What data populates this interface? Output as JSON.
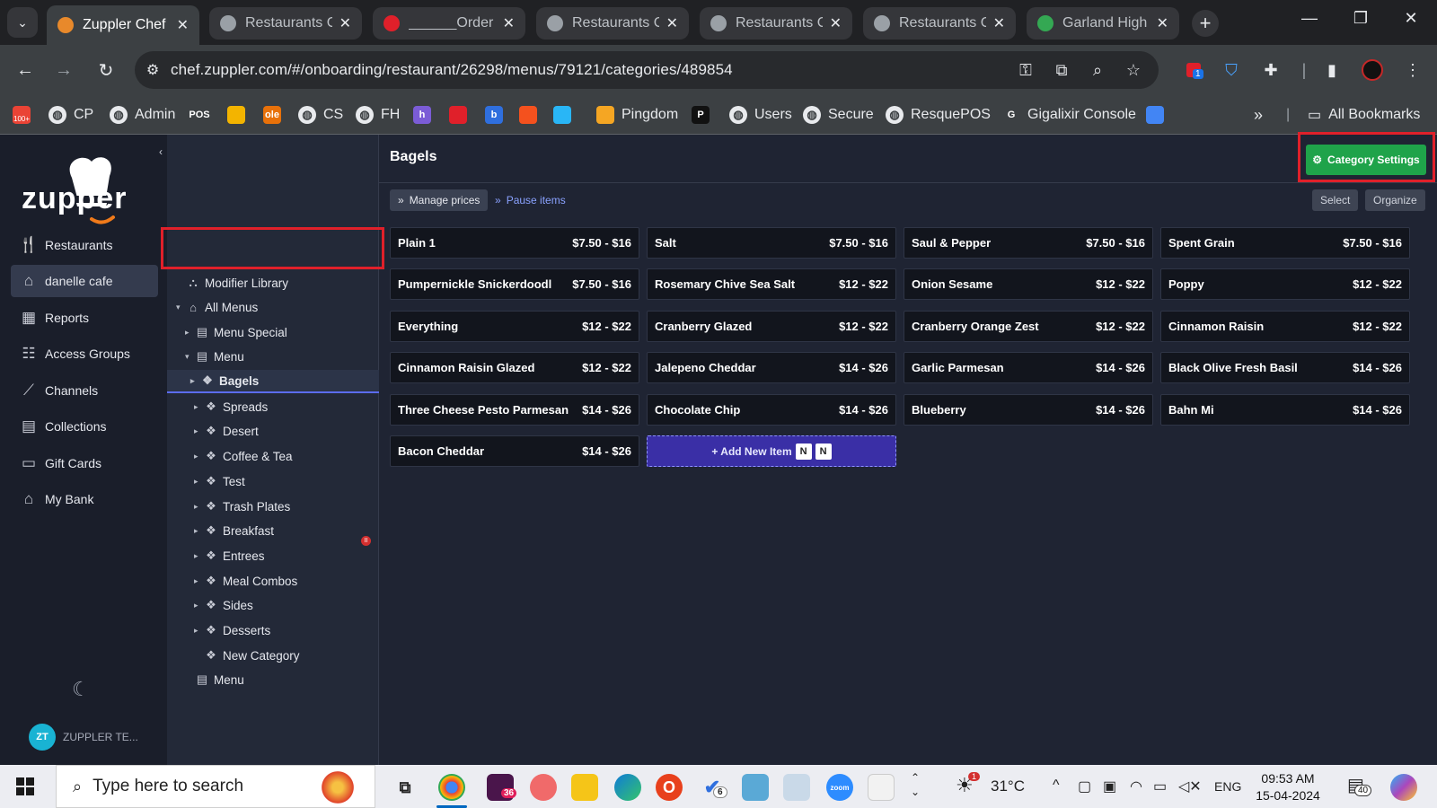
{
  "browser": {
    "tabs": [
      {
        "label": "Zuppler Chef",
        "active": true,
        "icon": "chef-hat-icon",
        "color": "#e8892b"
      },
      {
        "label": "Restaurants C",
        "active": false,
        "icon": "globe-icon",
        "color": "#9aa0a6"
      },
      {
        "label": "______Order",
        "active": false,
        "icon": "opera-icon",
        "color": "#e0202a"
      },
      {
        "label": "Restaurants C",
        "active": false,
        "icon": "globe-icon",
        "color": "#9aa0a6"
      },
      {
        "label": "Restaurants C",
        "active": false,
        "icon": "globe-icon",
        "color": "#9aa0a6"
      },
      {
        "label": "Restaurants C",
        "active": false,
        "icon": "globe-icon",
        "color": "#9aa0a6"
      },
      {
        "label": "Garland High",
        "active": false,
        "icon": "maps-pin-icon",
        "color": "#34a853"
      }
    ],
    "url": "chef.zuppler.com/#/onboarding/restaurant/26298/menus/79121/categories/489854",
    "extension_badge": "1",
    "bookmarks": [
      {
        "label": "",
        "icon": "gmail-icon",
        "color": "#ea4335",
        "badge": "100+"
      },
      {
        "label": "CP",
        "icon": "globe-icon"
      },
      {
        "label": "Admin",
        "icon": "globe-icon"
      },
      {
        "label": "",
        "icon": "pos-icon",
        "color": "#3c4043",
        "text": "POS"
      },
      {
        "label": "",
        "icon": "app-icon",
        "color": "#f3b400"
      },
      {
        "label": "",
        "icon": "ole-icon",
        "color": "#e8710a",
        "text": "ole"
      },
      {
        "label": "CS",
        "icon": "globe-icon"
      },
      {
        "label": "FH",
        "icon": "globe-icon"
      },
      {
        "label": "",
        "icon": "heroku-icon",
        "color": "#7b5cd6",
        "text": "h"
      },
      {
        "label": "",
        "icon": "target-icon",
        "color": "#e0202a"
      },
      {
        "label": "",
        "icon": "b-icon",
        "color": "#2f6fde",
        "text": "b"
      },
      {
        "label": "",
        "icon": "slash-icon",
        "color": "#f4511e"
      },
      {
        "label": "",
        "icon": "blocks-icon",
        "color": "#29b6f6"
      },
      {
        "label": "Pingdom",
        "icon": "pingdom-icon",
        "color": "#f5a623"
      },
      {
        "label": "",
        "icon": "paypal-icon",
        "color": "#111111",
        "text": "P"
      },
      {
        "label": "Users",
        "icon": "globe-icon"
      },
      {
        "label": "Secure",
        "icon": "globe-icon"
      },
      {
        "label": "ResquePOS",
        "icon": "globe-icon"
      },
      {
        "label": "Gigalixir Console",
        "icon": "g-icon",
        "color": "#3c4043",
        "text": "G"
      },
      {
        "label": "",
        "icon": "assistant-icon",
        "color": "#4285f4"
      }
    ],
    "more_label": "»",
    "all_bookmarks_label": "All Bookmarks"
  },
  "sidebar": {
    "brand": "zupper",
    "items": [
      {
        "label": "Restaurants",
        "icon": "cutlery-icon",
        "selected": false
      },
      {
        "label": "danelle cafe",
        "icon": "home-icon",
        "selected": true
      },
      {
        "label": "Reports",
        "icon": "chart-icon",
        "selected": false
      },
      {
        "label": "Access Groups",
        "icon": "users-icon",
        "selected": false
      },
      {
        "label": "Channels",
        "icon": "broadcast-icon",
        "selected": false
      },
      {
        "label": "Collections",
        "icon": "collections-icon",
        "selected": false
      },
      {
        "label": "Gift Cards",
        "icon": "gift-card-icon",
        "selected": false
      },
      {
        "label": "My Bank",
        "icon": "bank-icon",
        "selected": false
      }
    ],
    "user_initials": "ZT",
    "user_name": "ZUPPLER TE..."
  },
  "tree": {
    "nodes": [
      {
        "label": "Modifier Library",
        "icon": "sitemap-icon",
        "depth": 0,
        "caret": ""
      },
      {
        "label": "All Menus",
        "icon": "home-icon",
        "depth": 0,
        "caret": "▾"
      },
      {
        "label": "Menu Special",
        "icon": "list-icon",
        "depth": 1,
        "caret": "▸"
      },
      {
        "label": "Menu",
        "icon": "list-icon",
        "depth": 1,
        "caret": "▾"
      },
      {
        "label": "Bagels",
        "icon": "diamond-icon",
        "depth": 2,
        "caret": "▸",
        "selected": true
      },
      {
        "label": "Spreads",
        "icon": "diamond-icon",
        "depth": 2,
        "caret": "▸"
      },
      {
        "label": "Desert",
        "icon": "diamond-icon",
        "depth": 2,
        "caret": "▸"
      },
      {
        "label": "Coffee & Tea",
        "icon": "diamond-icon",
        "depth": 2,
        "caret": "▸"
      },
      {
        "label": "Test",
        "icon": "diamond-icon",
        "depth": 2,
        "caret": "▸"
      },
      {
        "label": "Trash Plates",
        "icon": "diamond-icon",
        "depth": 2,
        "caret": "▸"
      },
      {
        "label": "Breakfast",
        "icon": "diamond-icon",
        "depth": 2,
        "caret": "▸"
      },
      {
        "label": "Entrees",
        "icon": "diamond-icon",
        "depth": 2,
        "caret": "▸"
      },
      {
        "label": "Meal Combos",
        "icon": "diamond-icon",
        "depth": 2,
        "caret": "▸"
      },
      {
        "label": "Sides",
        "icon": "diamond-icon",
        "depth": 2,
        "caret": "▸"
      },
      {
        "label": "Desserts",
        "icon": "diamond-icon",
        "depth": 2,
        "caret": "▸"
      },
      {
        "label": "New Category",
        "icon": "diamond-icon",
        "depth": 2,
        "caret": ""
      },
      {
        "label": "Menu",
        "icon": "list-icon",
        "depth": 1,
        "caret": ""
      }
    ]
  },
  "main": {
    "title": "Bagels",
    "settings_label": "Category Settings",
    "manage_prices_label": "Manage prices",
    "pause_items_label": "Pause items",
    "select_label": "Select",
    "organize_label": "Organize",
    "add_item_label": "+ Add New Item",
    "add_item_keys": [
      "N",
      "N"
    ],
    "items": [
      {
        "name": "Plain 1",
        "price": "$7.50 - $16"
      },
      {
        "name": "Salt",
        "price": "$7.50 - $16"
      },
      {
        "name": "Saul & Pepper",
        "price": "$7.50 - $16"
      },
      {
        "name": "Spent Grain",
        "price": "$7.50 - $16"
      },
      {
        "name": "Pumpernickle Snickerdoodl",
        "price": "$7.50 - $16"
      },
      {
        "name": "Rosemary Chive Sea Salt",
        "price": "$12 - $22"
      },
      {
        "name": "Onion Sesame",
        "price": "$12 - $22"
      },
      {
        "name": "Poppy",
        "price": "$12 - $22"
      },
      {
        "name": "Everything",
        "price": "$12 - $22"
      },
      {
        "name": "Cranberry Glazed",
        "price": "$12 - $22"
      },
      {
        "name": "Cranberry Orange Zest",
        "price": "$12 - $22"
      },
      {
        "name": "Cinnamon Raisin",
        "price": "$12 - $22"
      },
      {
        "name": "Cinnamon Raisin Glazed",
        "price": "$12 - $22"
      },
      {
        "name": "Jalepeno Cheddar",
        "price": "$14 - $26"
      },
      {
        "name": "Garlic Parmesan",
        "price": "$14 - $26"
      },
      {
        "name": "Black Olive Fresh Basil",
        "price": "$14 - $26"
      },
      {
        "name": "Three Cheese Pesto Parmesan",
        "price": "$14 - $26"
      },
      {
        "name": "Chocolate Chip",
        "price": "$14 - $26"
      },
      {
        "name": "Blueberry",
        "price": "$14 - $26"
      },
      {
        "name": "Bahn Mi",
        "price": "$14 - $26"
      },
      {
        "name": "Bacon Cheddar",
        "price": "$14 - $26"
      }
    ]
  },
  "taskbar": {
    "search_placeholder": "Type here to search",
    "slack_badge": "36",
    "todo_badge": "6",
    "weather_temp": "31°C",
    "weather_badge": "1",
    "language": "ENG",
    "time": "09:53 AM",
    "date": "15-04-2024",
    "notification_count": "40"
  },
  "colors": {
    "accent_green": "#1fa34a",
    "highlight_red": "#e0202a",
    "add_item_purple": "#3a2fa6",
    "selection_blue": "#5b6cf0"
  }
}
